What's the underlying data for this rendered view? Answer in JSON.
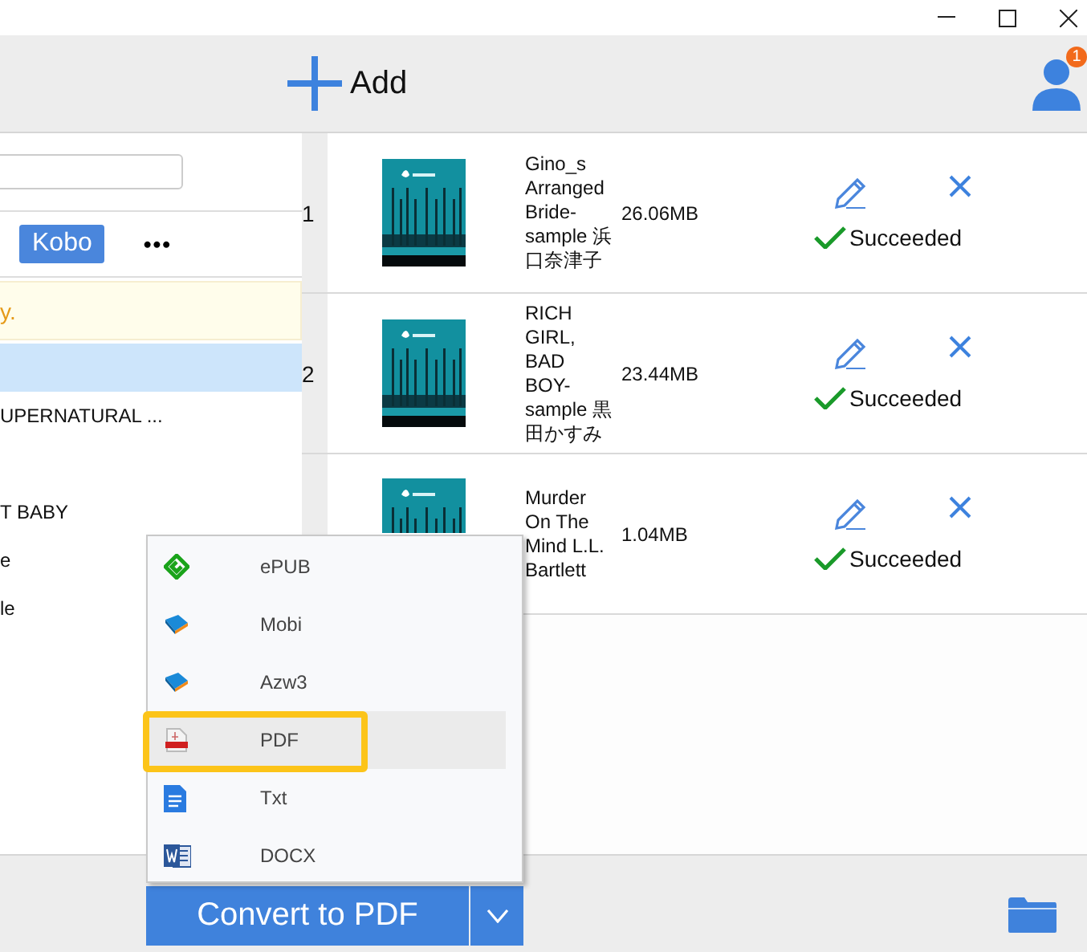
{
  "toolbar": {
    "add_label": "Add",
    "notification_count": "1"
  },
  "library": {
    "tabs": [
      {
        "label": "Kobo",
        "selected": true
      }
    ],
    "more_label": "•••",
    "notice": "y.",
    "books": [
      {
        "selected": true
      },
      {
        "title": "UPERNATURAL ...",
        "selected": false
      },
      {
        "selected": false
      },
      {
        "title": "T BABY",
        "selected": false
      },
      {
        "title": "e",
        "selected": false
      },
      {
        "title": "le",
        "selected": false
      }
    ]
  },
  "conversions": [
    {
      "number": "1",
      "title": "Gino_s Arranged Bride-sample 浜口奈津子",
      "size": "26.06MB",
      "status": "Succeeded"
    },
    {
      "number": "2",
      "title": "RICH GIRL, BAD BOY-sample 黒田かすみ",
      "size": "23.44MB",
      "status": "Succeeded"
    },
    {
      "title": "Murder On The Mind L.L. Bartlett",
      "size": "1.04MB",
      "status": "Succeeded"
    }
  ],
  "format_menu": {
    "items": [
      {
        "label": "ePUB",
        "kind": "epub",
        "selected": false
      },
      {
        "label": "Mobi",
        "kind": "mobi",
        "selected": false
      },
      {
        "label": "Azw3",
        "kind": "azw3",
        "selected": false
      },
      {
        "label": "PDF",
        "kind": "pdf",
        "selected": true
      },
      {
        "label": "Txt",
        "kind": "txt",
        "selected": false
      },
      {
        "label": "DOCX",
        "kind": "docx",
        "selected": false
      }
    ]
  },
  "convert_button": {
    "label": "Convert to PDF"
  }
}
